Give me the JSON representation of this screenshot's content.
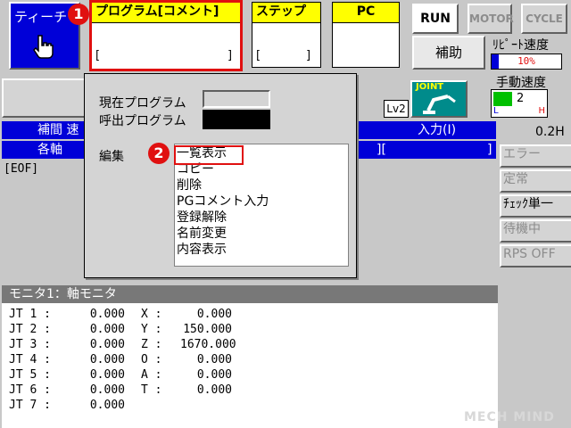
{
  "teach_button": {
    "label": "ティーチ"
  },
  "header": {
    "program": {
      "title": "プログラム[コメント]",
      "bracket_open": "[",
      "bracket_close": "]"
    },
    "step": {
      "title": "ステップ",
      "bracket_open": "[",
      "bracket_close": "]"
    },
    "pc": {
      "title": "PC"
    }
  },
  "mode_buttons": {
    "run": "RUN",
    "motor": "MOTOR",
    "cycle": "CYCLE"
  },
  "aux_button": {
    "label": "補助"
  },
  "repeat_speed": {
    "label": "ﾘﾋﾟｰﾄ速度",
    "value": "10%",
    "level": 0.1
  },
  "manual_speed": {
    "label": "手動速度",
    "value": "2",
    "low": "L",
    "high": "H",
    "level": 0.35
  },
  "joint_button": {
    "label": "JOINT"
  },
  "level_badge": {
    "label": "Lv2"
  },
  "background_bars": {
    "row1_left": "補間 速",
    "row1_right": "入力(I)",
    "row1_paren": ")",
    "row2_left": "各軸",
    "row2_bracket": "][",
    "row2_end": "]",
    "eof": "[EOF]",
    "value_right": "0.2H"
  },
  "status_buttons": [
    {
      "label": "エラー",
      "active": false
    },
    {
      "label": "定常",
      "active": false
    },
    {
      "label": "ﾁｪｯｸ単一",
      "active": true
    },
    {
      "label": "待機中",
      "active": false
    },
    {
      "label": "RPS OFF",
      "active": false
    }
  ],
  "popup": {
    "current_program_label": "現在プログラム",
    "call_program_label": "呼出プログラム",
    "edit_label": "編集",
    "menu_items": [
      "一覧表示",
      "コピー",
      "削除",
      "PGコメント入力",
      "登録解除",
      "名前変更",
      "内容表示"
    ]
  },
  "markers": [
    "1",
    "2"
  ],
  "monitor": {
    "title": "モニタ1：軸モニタ",
    "rows": [
      {
        "jt": "JT 1 :",
        "jv": "0.000",
        "axis": "X :",
        "av": "0.000"
      },
      {
        "jt": "JT 2 :",
        "jv": "0.000",
        "axis": "Y :",
        "av": "150.000"
      },
      {
        "jt": "JT 3 :",
        "jv": "0.000",
        "axis": "Z :",
        "av": "1670.000"
      },
      {
        "jt": "JT 4 :",
        "jv": "0.000",
        "axis": "O :",
        "av": "0.000"
      },
      {
        "jt": "JT 5 :",
        "jv": "0.000",
        "axis": "A :",
        "av": "0.000"
      },
      {
        "jt": "JT 6 :",
        "jv": "0.000",
        "axis": "T :",
        "av": "0.000"
      },
      {
        "jt": "JT 7 :",
        "jv": "0.000",
        "axis": "",
        "av": ""
      }
    ]
  },
  "watermark": {
    "text": "MECH MIND"
  }
}
